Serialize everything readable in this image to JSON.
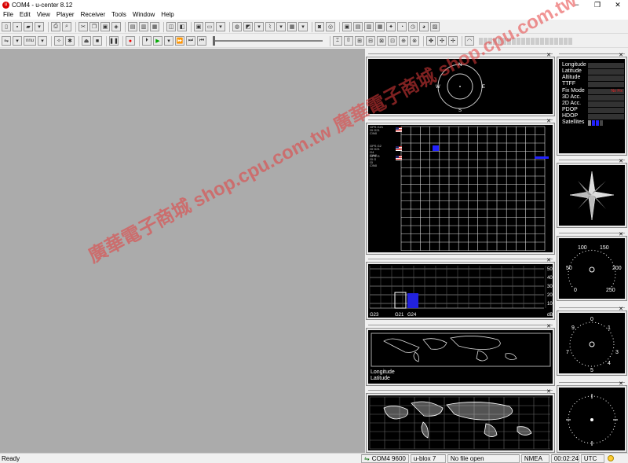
{
  "window": {
    "title": "COM4 - u-center 8.12"
  },
  "menu": [
    "File",
    "Edit",
    "View",
    "Player",
    "Receiver",
    "Tools",
    "Window",
    "Help"
  ],
  "toolbar2": {
    "baud_label": "nnu"
  },
  "panels": {
    "compass": {
      "n": "N",
      "e": "E",
      "s": "S",
      "w": "W"
    },
    "sky": {
      "groups": [
        [
          "GPS G21",
          "Gl G21",
          "C/N0"
        ],
        [
          "GPS G2",
          "Gl G21",
          "G4",
          "C/N0"
        ],
        [
          "GPS G",
          "Gl G",
          "Gl",
          "C/N0"
        ]
      ]
    },
    "signal": {
      "y_ticks": [
        "50",
        "40",
        "30",
        "20",
        "10"
      ],
      "x_labels": [
        "G23",
        "G21",
        "G24"
      ],
      "unit": "dB"
    },
    "map": {
      "longitude_label": "Longitude",
      "latitude_label": "Latitude"
    },
    "info": {
      "rows": [
        "Longitude",
        "Latitude",
        "Altitude",
        "TTFF",
        "Fix Mode",
        "3D Acc.",
        "2D Acc.",
        "PDOP",
        "HDOP",
        "Satellites"
      ],
      "fix_mode_value": "No Fix"
    },
    "speedo": {
      "ticks": [
        "100",
        "150",
        "50",
        "200",
        "0",
        "250"
      ]
    },
    "clock": {
      "ticks": [
        "0",
        "1",
        "9",
        "3",
        "7",
        "5",
        "4"
      ]
    }
  },
  "watermark": "廣華電子商城 shop.cpu.com.tw 廣華電子商城 shop.cpu.com.tw",
  "status": {
    "ready": "Ready",
    "port": "COM4 9600",
    "receiver": "u-blox 7",
    "file": "No file open",
    "protocol": "NMEA",
    "elapsed": "00:02:24",
    "timezone": "UTC"
  }
}
